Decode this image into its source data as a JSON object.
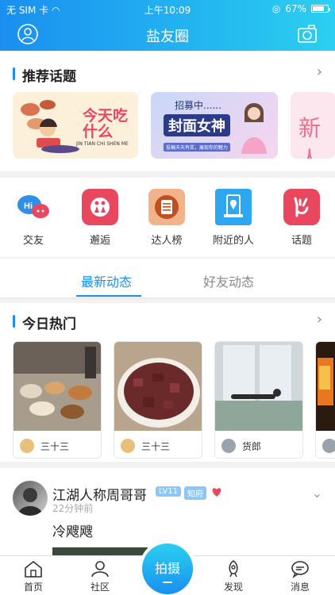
{
  "status_bar": {
    "carrier": "无 SIM 卡",
    "time": "上午10:09",
    "battery": "67%",
    "battery_level": 0.67
  },
  "header": {
    "title": "盐友圈"
  },
  "topics": {
    "title": "推荐话题",
    "cards": [
      {
        "title": "今天吃什么",
        "subtitle": "JIN TIAN CHI SHEN ME"
      },
      {
        "title": "封面女神",
        "ribbon": "招募中......",
        "note": "投稿天天有奖，展现你的魅力"
      },
      {
        "title": "新人"
      }
    ]
  },
  "shortcuts": [
    {
      "label": "交友",
      "icon": "chat-bubbles-icon",
      "badge": "Hi"
    },
    {
      "label": "邂逅",
      "icon": "couple-icon"
    },
    {
      "label": "达人榜",
      "icon": "list-board-icon"
    },
    {
      "label": "附近的人",
      "icon": "location-pin-icon"
    },
    {
      "label": "话题",
      "icon": "hand-gesture-icon"
    }
  ],
  "tabs": [
    {
      "label": "最新动态",
      "active": true
    },
    {
      "label": "好友动态",
      "active": false
    }
  ],
  "hot": {
    "title": "今日热门",
    "cards": [
      {
        "user": "三十三"
      },
      {
        "user": "三十三"
      },
      {
        "user": "货郎"
      },
      {
        "user": ""
      }
    ]
  },
  "post": {
    "username": "江湖人称周哥哥",
    "level": "LV11",
    "title_badge": "知府",
    "time": "22分钟前",
    "text": "冷飕飕"
  },
  "bottom_nav": {
    "items": [
      {
        "label": "首页",
        "icon": "home-icon"
      },
      {
        "label": "社区",
        "icon": "community-icon"
      },
      {
        "label": "发现",
        "icon": "rocket-icon"
      },
      {
        "label": "消息",
        "icon": "message-icon"
      }
    ],
    "shoot_label": "拍摄"
  },
  "colors": {
    "accent": "#1a8ff0",
    "accent_light": "#2ad0f0",
    "level_badge": "#8ec7f5",
    "title_badge": "#8ec7f5",
    "heart": "#e8475f"
  }
}
